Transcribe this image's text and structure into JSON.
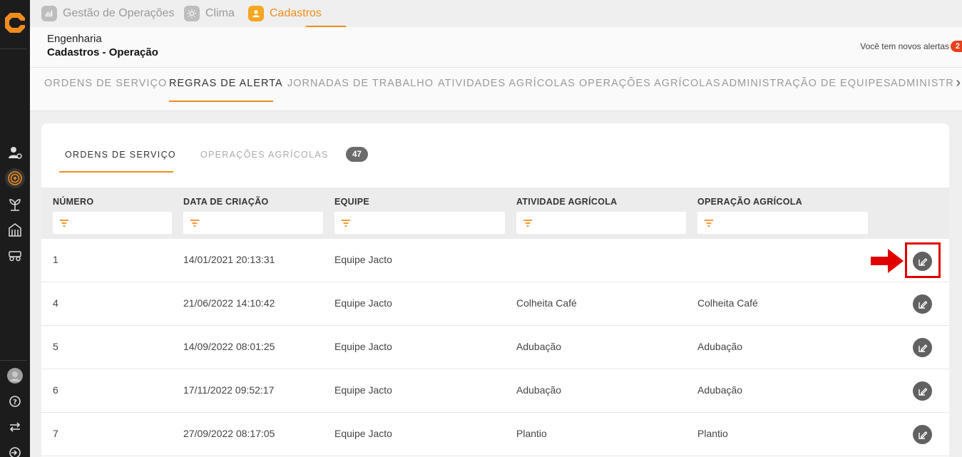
{
  "modules": [
    {
      "label": "Gestão de Operações",
      "icon": "chart-icon"
    },
    {
      "label": "Clima",
      "icon": "sun-icon"
    },
    {
      "label": "Cadastros",
      "icon": "user-icon",
      "active": true
    }
  ],
  "header": {
    "subtitle": "Engenharia",
    "title": "Cadastros - Operação",
    "alert_text": "Você tem novos alertas",
    "alert_count": "2"
  },
  "main_tabs": [
    {
      "label": "ORDENS DE SERVIÇO"
    },
    {
      "label": "REGRAS DE ALERTA",
      "active": true
    },
    {
      "label": "JORNADAS DE TRABALHO"
    },
    {
      "label": "ATIVIDADES AGRÍCOLAS"
    },
    {
      "label": "OPERAÇÕES AGRÍCOLAS"
    },
    {
      "label": "ADMINISTRAÇÃO DE EQUIPES"
    },
    {
      "label": "ADMINISTR"
    }
  ],
  "sub_tabs": [
    {
      "label": "ORDENS DE SERVIÇO",
      "active": true
    },
    {
      "label": "OPERAÇÕES AGRÍCOLAS"
    }
  ],
  "count_badge": "47",
  "table": {
    "columns": [
      "NÚMERO",
      "DATA DE CRIAÇÃO",
      "EQUIPE",
      "ATIVIDADE AGRÍCOLA",
      "OPERAÇÃO AGRÍCOLA"
    ],
    "rows": [
      [
        "1",
        "14/01/2021 20:13:31",
        "Equipe Jacto",
        "",
        ""
      ],
      [
        "4",
        "21/06/2022 14:10:42",
        "Equipe Jacto",
        "Colheita Café",
        "Colheita Café"
      ],
      [
        "5",
        "14/09/2022 08:01:25",
        "Equipe Jacto",
        "Adubação",
        "Adubação"
      ],
      [
        "6",
        "17/11/2022 09:52:17",
        "Equipe Jacto",
        "Adubação",
        "Adubação"
      ],
      [
        "7",
        "27/09/2022 08:17:05",
        "Equipe Jacto",
        "Plantio",
        "Plantio"
      ]
    ]
  },
  "colors": {
    "accent": "#f08c1e",
    "sidebar": "#1c1c1c",
    "highlight": "#e00000"
  }
}
